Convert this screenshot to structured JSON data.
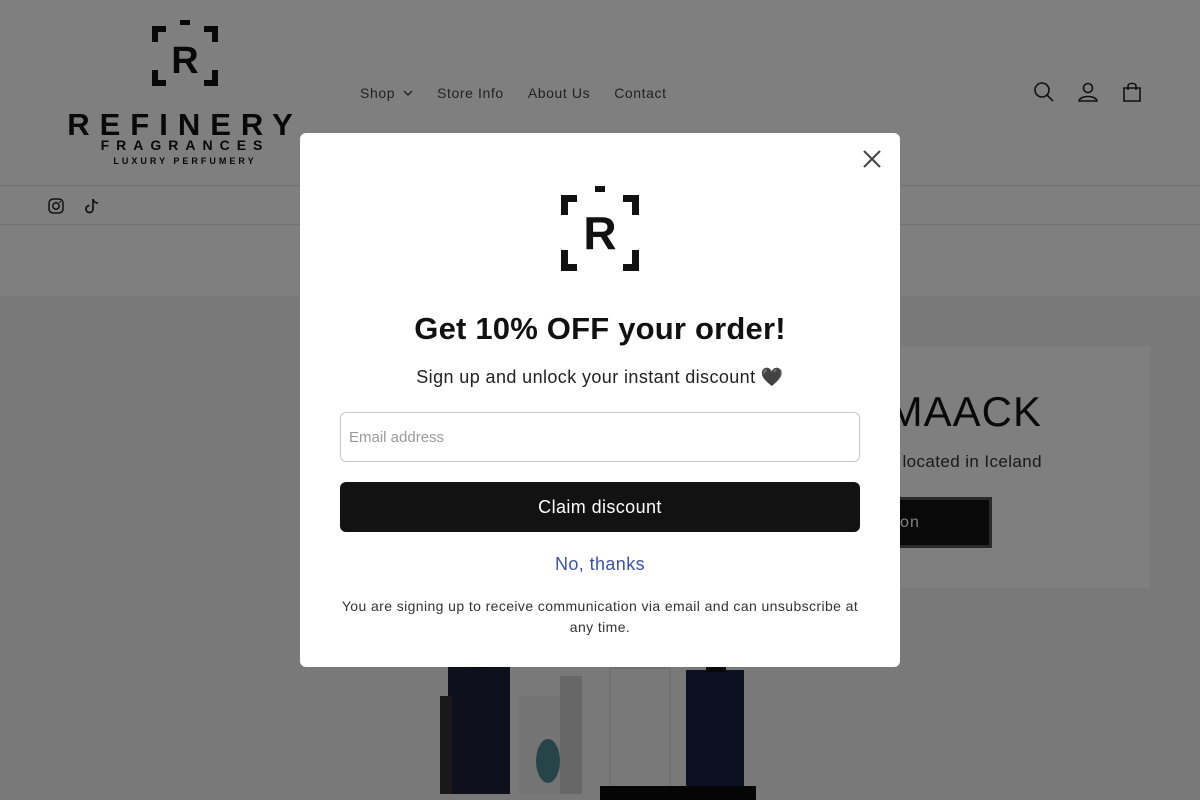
{
  "header": {
    "logo": {
      "name": "REFINERY",
      "sub": "FRAGRANCES",
      "tagline": "LUXURY PERFUMERY"
    },
    "nav": [
      {
        "label": "Shop",
        "has_dropdown": true
      },
      {
        "label": "Store Info"
      },
      {
        "label": "About Us"
      },
      {
        "label": "Contact"
      }
    ],
    "icons": [
      "search-icon",
      "account-icon",
      "cart-icon"
    ]
  },
  "social": [
    "instagram-icon",
    "tiktok-icon"
  ],
  "hero": {
    "title": "A MAACK",
    "subtitle": "fume house located in Iceland",
    "button_label": "ollection"
  },
  "modal": {
    "heading": "Get 10% OFF your order!",
    "subheading": "Sign up and unlock your instant discount 🖤",
    "email_placeholder": "Email address",
    "claim_label": "Claim discount",
    "decline_label": "No, thanks",
    "disclaimer": "You are signing up to receive communication via email and can unsubscribe at any time."
  },
  "colors": {
    "overlay": "rgba(0,0,0,0.5)",
    "button": "#121212",
    "link": "#3b52a8"
  }
}
